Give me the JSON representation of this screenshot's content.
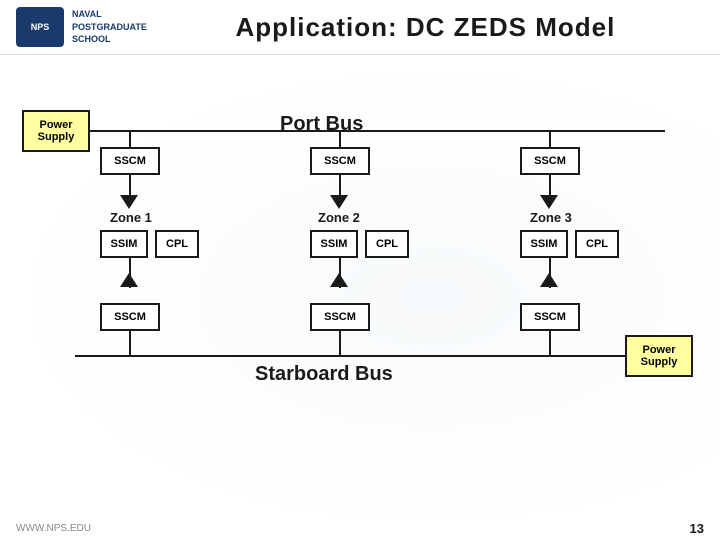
{
  "header": {
    "logo_line1": "NPS",
    "school_line1": "NAVAL",
    "school_line2": "POSTGRADUATE",
    "school_line3": "SCHOOL",
    "title": "Application:  DC ZEDS Model"
  },
  "diagram": {
    "port_bus_label": "Port Bus",
    "starboard_bus_label": "Starboard Bus",
    "power_supply_label": "Power Supply",
    "power_supply2_label": "Power Supply",
    "sscm_label": "SSCM",
    "zone1_label": "Zone 1",
    "zone2_label": "Zone 2",
    "zone3_label": "Zone 3",
    "ssim_label": "SSIM",
    "cpl_label": "CPL"
  },
  "footer": {
    "website": "WWW.NPS.EDU",
    "page_number": "13"
  }
}
